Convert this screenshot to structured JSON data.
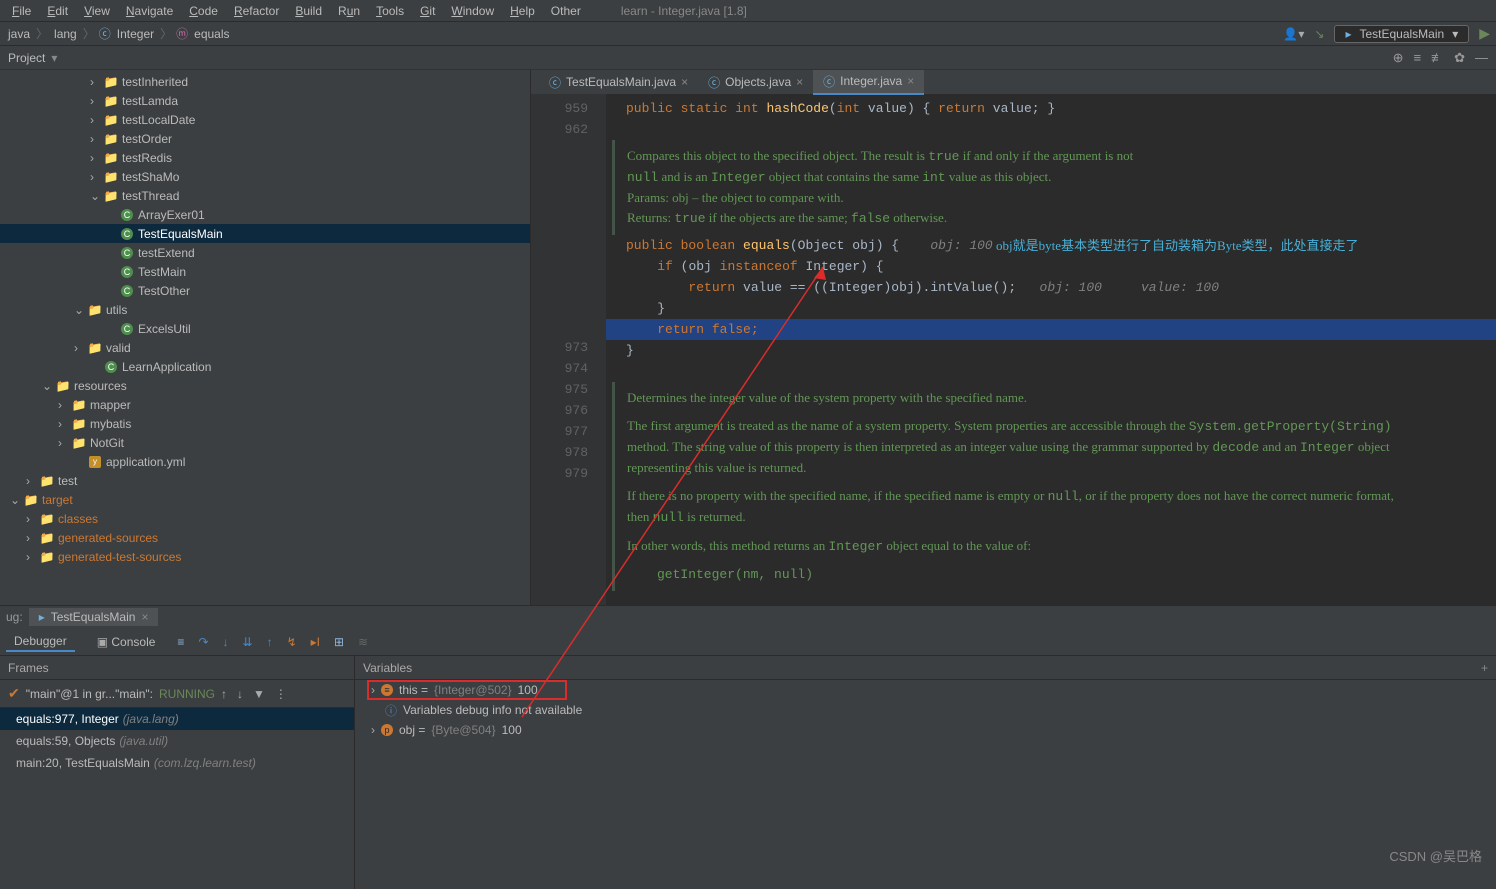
{
  "window": {
    "title": "learn - Integer.java [1.8]",
    "menus": [
      "File",
      "Edit",
      "View",
      "Navigate",
      "Code",
      "Refactor",
      "Build",
      "Run",
      "Tools",
      "Git",
      "Window",
      "Help",
      "Other"
    ]
  },
  "breadcrumbs": [
    "java",
    "lang",
    "Integer",
    "equals"
  ],
  "runconfig": "TestEqualsMain",
  "project": {
    "title": "Project",
    "tree": [
      {
        "indent": 5,
        "arrow": ">",
        "icon": "folder",
        "label": "testInherited"
      },
      {
        "indent": 5,
        "arrow": ">",
        "icon": "folder",
        "label": "testLamda"
      },
      {
        "indent": 5,
        "arrow": ">",
        "icon": "folder",
        "label": "testLocalDate"
      },
      {
        "indent": 5,
        "arrow": ">",
        "icon": "folder",
        "label": "testOrder"
      },
      {
        "indent": 5,
        "arrow": ">",
        "icon": "folder",
        "label": "testRedis"
      },
      {
        "indent": 5,
        "arrow": ">",
        "icon": "folder",
        "label": "testShaMo"
      },
      {
        "indent": 5,
        "arrow": "v",
        "icon": "folder",
        "label": "testThread"
      },
      {
        "indent": 6,
        "arrow": "",
        "icon": "class",
        "label": "ArrayExer01"
      },
      {
        "indent": 6,
        "arrow": "",
        "icon": "class",
        "label": "TestEqualsMain",
        "sel": true
      },
      {
        "indent": 6,
        "arrow": "",
        "icon": "class",
        "label": "testExtend"
      },
      {
        "indent": 6,
        "arrow": "",
        "icon": "class",
        "label": "TestMain"
      },
      {
        "indent": 6,
        "arrow": "",
        "icon": "class",
        "label": "TestOther"
      },
      {
        "indent": 4,
        "arrow": "v",
        "icon": "folder",
        "label": "utils"
      },
      {
        "indent": 6,
        "arrow": "",
        "icon": "class",
        "label": "ExcelsUtil"
      },
      {
        "indent": 4,
        "arrow": ">",
        "icon": "folder",
        "label": "valid"
      },
      {
        "indent": 5,
        "arrow": "",
        "icon": "class",
        "label": "LearnApplication"
      },
      {
        "indent": 2,
        "arrow": "v",
        "icon": "folder",
        "label": "resources"
      },
      {
        "indent": 3,
        "arrow": ">",
        "icon": "folder",
        "label": "mapper"
      },
      {
        "indent": 3,
        "arrow": ">",
        "icon": "folder",
        "label": "mybatis"
      },
      {
        "indent": 3,
        "arrow": ">",
        "icon": "folder",
        "label": "NotGit"
      },
      {
        "indent": 4,
        "arrow": "",
        "icon": "xml",
        "label": "application.yml"
      },
      {
        "indent": 1,
        "arrow": ">",
        "icon": "folder",
        "label": "test"
      },
      {
        "indent": 0,
        "arrow": "v",
        "icon": "ofolder",
        "label": "target"
      },
      {
        "indent": 1,
        "arrow": ">",
        "icon": "ofolder",
        "label": "classes"
      },
      {
        "indent": 1,
        "arrow": ">",
        "icon": "ofolder",
        "label": "generated-sources"
      },
      {
        "indent": 1,
        "arrow": ">",
        "icon": "ofolder",
        "label": "generated-test-sources"
      }
    ]
  },
  "tabs": [
    {
      "name": "TestEqualsMain.java",
      "closable": true
    },
    {
      "name": "Objects.java",
      "closable": true
    },
    {
      "name": "Integer.java",
      "closable": true,
      "active": true
    }
  ],
  "gutter": [
    "959",
    "962",
    "",
    "",
    "",
    "",
    "",
    "973",
    "974",
    "975",
    "976",
    "977",
    "978",
    "979",
    "",
    "",
    "",
    "",
    "",
    "",
    "",
    "",
    ""
  ],
  "code": {
    "line959": {
      "public": "public",
      "static": "static",
      "int": "int",
      "fn": "hashCode",
      "p": "int",
      "pn": "value",
      "ret": "return",
      "rv": "value;"
    },
    "doc1": {
      "l1": "Compares this object to the specified object. The result is ",
      "c1": "true",
      "l1b": " if and only if the argument is not ",
      "c2": "null",
      "l2": " and is an ",
      "c3": "Integer",
      "l2b": " object that contains the same ",
      "c4": "int",
      "l2c": " value as this object.",
      "l3": "Params:  obj – the object to compare with.",
      "l4": "Returns: ",
      "c5": "true",
      "l4b": " if the objects are the same; ",
      "c6": "false",
      "l4c": " otherwise."
    },
    "eq": {
      "public": "public",
      "bool": "boolean",
      "fn": "equals",
      "pt": "Object",
      "pn": "obj",
      "cmt": "obj: 100",
      "anno": "obj就是byte基本类型进行了自动装箱为Byte类型，此处直接走了"
    },
    "if": {
      "if": "if",
      "obj": "(obj",
      "inst": "instanceof",
      "Integer": "Integer)"
    },
    "ret1": {
      "ret": "return",
      "val": "value",
      "eq": "==",
      "cast": "((Integer)obj).intValue();",
      "cmt1": "obj: 100",
      "cmt2": "value: 100"
    },
    "ret2": {
      "ret": "return",
      "false": "false;"
    },
    "doc2": {
      "l1": "Determines the integer value of the system property with the specified name.",
      "l2a": "The first argument is treated as the name of a system property. System properties are accessible through the ",
      "c1": "System.getProperty(String)",
      "l2b": " method. The string value of this property is then interpreted as an integer value using the grammar supported by ",
      "c2": "decode",
      "l2c": " and an ",
      "c3": "Integer",
      "l2d": " object representing this value is returned.",
      "l3a": "If there is no property with the specified name, if the specified name is empty or ",
      "c4": "null",
      "l3b": ", or if the property does not have the correct numeric format, then ",
      "c5": "null",
      "l3c": " is returned.",
      "l4a": "In other words, this method returns an ",
      "c6": "Integer",
      "l4b": " object equal to the value of:",
      "l5": "getInteger(nm, null)"
    }
  },
  "debug": {
    "tab": "TestEqualsMain",
    "sub1": "Debugger",
    "sub2": "Console",
    "framesTitle": "Frames",
    "thread": "\"main\"@1 in gr...\"main\": ",
    "threadState": "RUNNING",
    "frames": [
      {
        "sel": true,
        "m": "equals:977, Integer ",
        "p": "(java.lang)"
      },
      {
        "m": "equals:59, Objects ",
        "p": "(java.util)"
      },
      {
        "m": "main:20, TestEqualsMain ",
        "p": "(com.lzq.learn.test)"
      }
    ],
    "varsTitle": "Variables",
    "vars": [
      {
        "arrow": ">",
        "k": "this = ",
        "t": "{Integer@502}",
        "v": " 100",
        "hl": true,
        "icon": "y"
      },
      {
        "icon": "i",
        "k": "Variables debug info not available"
      },
      {
        "arrow": ">",
        "icon": "p",
        "k": "obj = ",
        "t": "{Byte@504}",
        "v": " 100"
      }
    ]
  },
  "watermark": "CSDN @吴巴格"
}
